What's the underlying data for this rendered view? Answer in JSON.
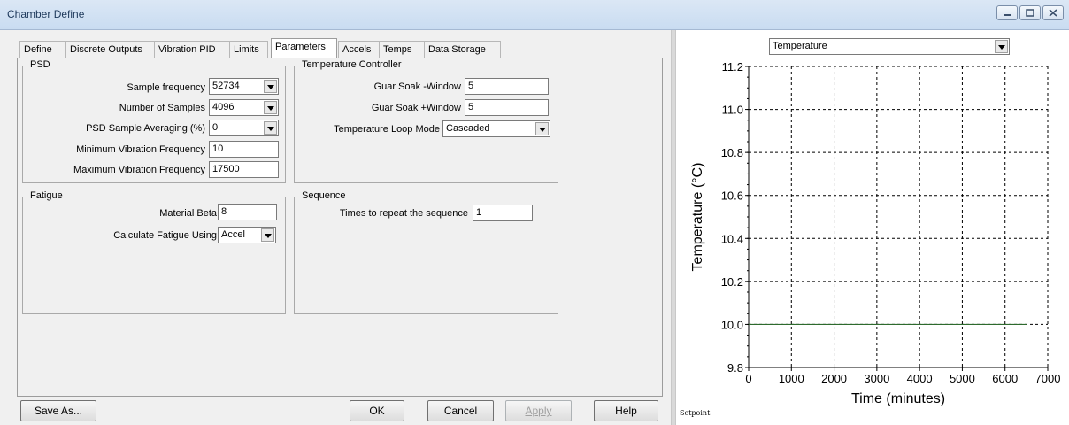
{
  "window": {
    "title": "Chamber Define"
  },
  "tabs": [
    {
      "label": "Define",
      "active": false
    },
    {
      "label": "Discrete Outputs",
      "active": false
    },
    {
      "label": "Vibration PID",
      "active": false
    },
    {
      "label": "Limits",
      "active": false
    },
    {
      "label": "Parameters",
      "active": true
    },
    {
      "label": "Accels",
      "active": false
    },
    {
      "label": "Temps",
      "active": false
    },
    {
      "label": "Data Storage",
      "active": false
    }
  ],
  "psd": {
    "title": "PSD",
    "sample_frequency": {
      "label": "Sample frequency",
      "value": "52734"
    },
    "number_of_samples": {
      "label": "Number of Samples",
      "value": "4096"
    },
    "sample_averaging": {
      "label": "PSD Sample Averaging (%)",
      "value": "0"
    },
    "min_vib_freq": {
      "label": "Minimum Vibration Frequency",
      "value": "10"
    },
    "max_vib_freq": {
      "label": "Maximum Vibration Frequency",
      "value": "17500"
    }
  },
  "temperature_controller": {
    "title": "Temperature Controller",
    "guar_soak_minus": {
      "label": "Guar Soak -Window",
      "value": "5"
    },
    "guar_soak_plus": {
      "label": "Guar Soak +Window",
      "value": "5"
    },
    "loop_mode": {
      "label": "Temperature Loop Mode",
      "value": "Cascaded"
    }
  },
  "fatigue": {
    "title": "Fatigue",
    "material_beta": {
      "label": "Material Beta",
      "value": "8"
    },
    "calculate_using": {
      "label": "Calculate Fatigue Using",
      "value": "Accel"
    }
  },
  "sequence": {
    "title": "Sequence",
    "times_repeat": {
      "label": "Times to repeat the sequence",
      "value": "1"
    }
  },
  "buttons": {
    "save_as": "Save As...",
    "ok": "OK",
    "cancel": "Cancel",
    "apply": "Apply",
    "help": "Help"
  },
  "plot_selector": {
    "value": "Temperature"
  },
  "setpoint_label": "Setpoint",
  "chart_data": {
    "type": "line",
    "xlabel": "Time (minutes)",
    "ylabel": "Temperature (°C)",
    "xlim": [
      0,
      7000
    ],
    "ylim": [
      9.8,
      11.2
    ],
    "x_ticks": [
      "0",
      "1000",
      "2000",
      "3000",
      "4000",
      "5000",
      "6000",
      "7000"
    ],
    "y_ticks": [
      "9.8",
      "10.0",
      "10.2",
      "10.4",
      "10.6",
      "10.8",
      "11.0",
      "11.2"
    ],
    "grid": true,
    "series": [
      {
        "x": [
          0,
          6500
        ],
        "y": [
          10.0,
          10.0
        ],
        "color": "#2e6b2e"
      }
    ]
  }
}
